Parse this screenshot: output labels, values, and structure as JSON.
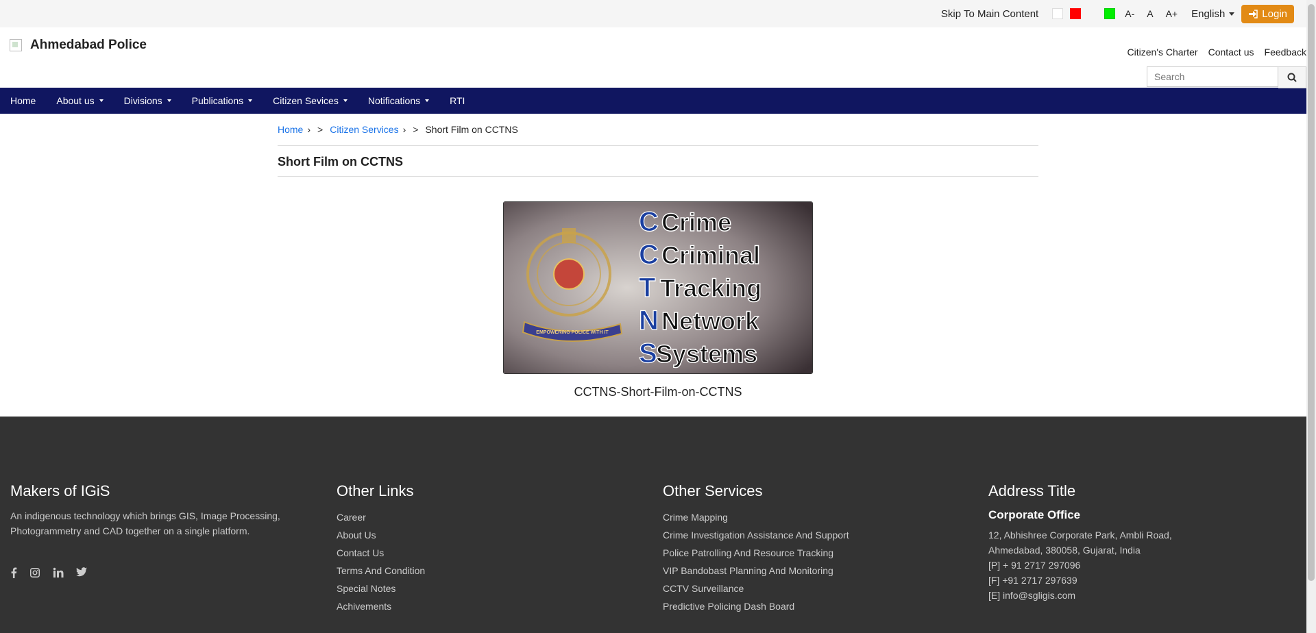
{
  "topbar": {
    "skip_link": "Skip To Main Content",
    "font_small": "A-",
    "font_normal": "A",
    "font_large": "A+",
    "language": "English",
    "login": "Login",
    "colors": {
      "white_theme": "#ffffff",
      "red_theme": "#ff0000",
      "green_theme": "#00ff00"
    }
  },
  "header": {
    "title": "Ahmedabad Police",
    "links": [
      "Citizen's Charter",
      "Contact us",
      "Feedback"
    ],
    "search_placeholder": "Search"
  },
  "nav": {
    "items": [
      {
        "label": "Home"
      },
      {
        "label": "About us"
      },
      {
        "label": "Divisions"
      },
      {
        "label": "Publications"
      },
      {
        "label": "Citizen Sevices"
      },
      {
        "label": "Notifications"
      },
      {
        "label": "RTI"
      }
    ]
  },
  "breadcrumb": {
    "home": "Home",
    "sep1": ">",
    "parent": "Citizen Services",
    "sep2": ">",
    "current": "Short Film on CCTNS"
  },
  "page": {
    "title": "Short Film on CCTNS",
    "video_caption": "CCTNS-Short-Film-on-CCTNS",
    "thumbnail": {
      "letters": [
        "C",
        "C",
        "T",
        "N",
        "S"
      ],
      "words": [
        "Crime",
        "Criminal",
        "Tracking",
        "Network",
        "Systems"
      ],
      "badge_text": "EMPOWERING POLICE WITH IT"
    }
  },
  "footer": {
    "makers": {
      "heading": "Makers of IGiS",
      "description": "An indigenous technology which brings GIS, Image Processing, Photogrammetry and CAD together on a single platform."
    },
    "other_links": {
      "heading": "Other Links",
      "items": [
        "Career",
        "About Us",
        "Contact Us",
        "Terms And Condition",
        "Special Notes",
        "Achivements"
      ]
    },
    "other_services": {
      "heading": "Other Services",
      "items": [
        "Crime Mapping",
        "Crime Investigation Assistance And Support",
        "Police Patrolling And Resource Tracking",
        "VIP Bandobast Planning And Monitoring",
        "CCTV Surveillance",
        "Predictive Policing Dash Board"
      ]
    },
    "address": {
      "heading": "Address Title",
      "office": "Corporate Office",
      "line1": "12, Abhishree Corporate Park, Ambli Road,",
      "line2": "Ahmedabad, 380058, Gujarat, India",
      "phone": "[P] + 91 2717 297096",
      "fax": "[F] +91 2717 297639",
      "email": "[E] info@sgligis.com"
    }
  }
}
